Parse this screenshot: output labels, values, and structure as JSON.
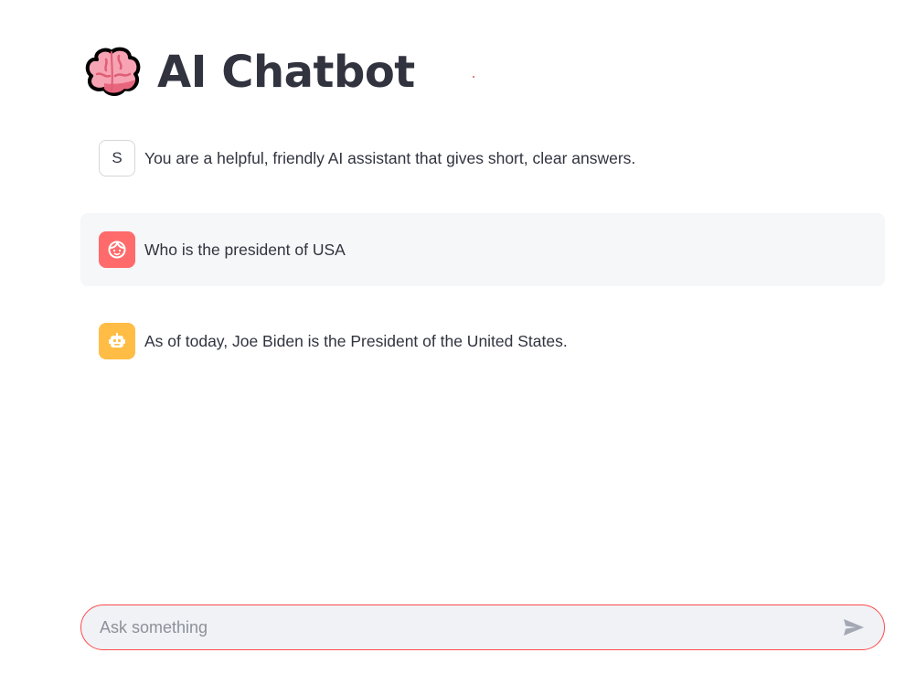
{
  "page": {
    "title": "AI Chatbot",
    "title_icon": "brain-icon"
  },
  "messages": [
    {
      "role": "system",
      "avatar_label": "S",
      "avatar_icon": "",
      "text": "You are a helpful, friendly AI assistant that gives short, clear answers."
    },
    {
      "role": "user",
      "avatar_label": "",
      "avatar_icon": "user-face-icon",
      "avatar_color": "#ff6b6b",
      "text": "Who is the president of USA"
    },
    {
      "role": "assistant",
      "avatar_label": "",
      "avatar_icon": "robot-icon",
      "avatar_color": "#ffbd45",
      "text": "As of today, Joe Biden is the President of the United States."
    }
  ],
  "chat_input": {
    "placeholder": "Ask something",
    "value": "",
    "send_icon": "send-icon"
  },
  "colors": {
    "accent": "#ff4b4b",
    "text": "#31333f",
    "user_message_bg": "#f6f7f9",
    "input_bg": "#f0f2f6"
  }
}
